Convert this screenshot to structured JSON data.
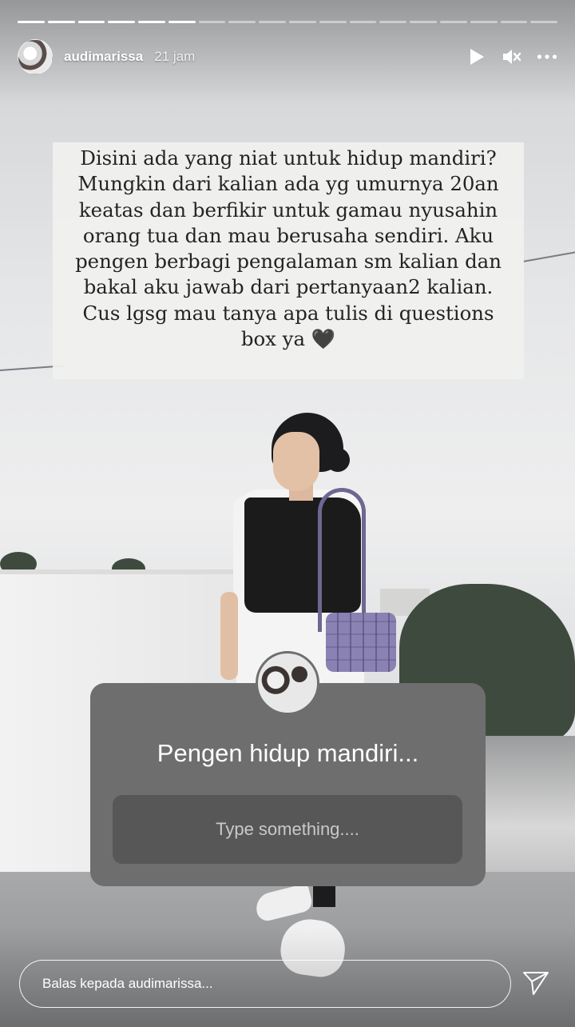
{
  "story": {
    "progress": {
      "total": 18,
      "completed": 6
    },
    "header": {
      "username": "audimarissa",
      "time": "21 jam",
      "icons": [
        "play-icon",
        "mute-icon",
        "more-icon"
      ]
    },
    "caption": {
      "lines": [
        "Disini ada yang niat untuk hidup mandiri?",
        "Mungkin dari kalian ada yg umurnya 20an",
        "keatas dan berfikir untuk gamau nyusahin",
        "orang tua dan mau berusaha sendiri. Aku",
        "pengen berbagi pengalaman sm kalian dan",
        "bakal aku jawab dari pertanyaan2 kalian.",
        "Cus lgsg mau tanya apa tulis di questions",
        "box ya 🖤"
      ]
    },
    "question_sticker": {
      "title": "Pengen hidup mandiri...",
      "input_placeholder": "Type something...."
    },
    "reply": {
      "placeholder": "Balas kepada audimarissa..."
    }
  },
  "colors": {
    "sticker_bg": "#6e6e6e",
    "sticker_input_bg": "#575757",
    "caption_bg": "#f0f0ee",
    "text_white": "#ffffff"
  }
}
